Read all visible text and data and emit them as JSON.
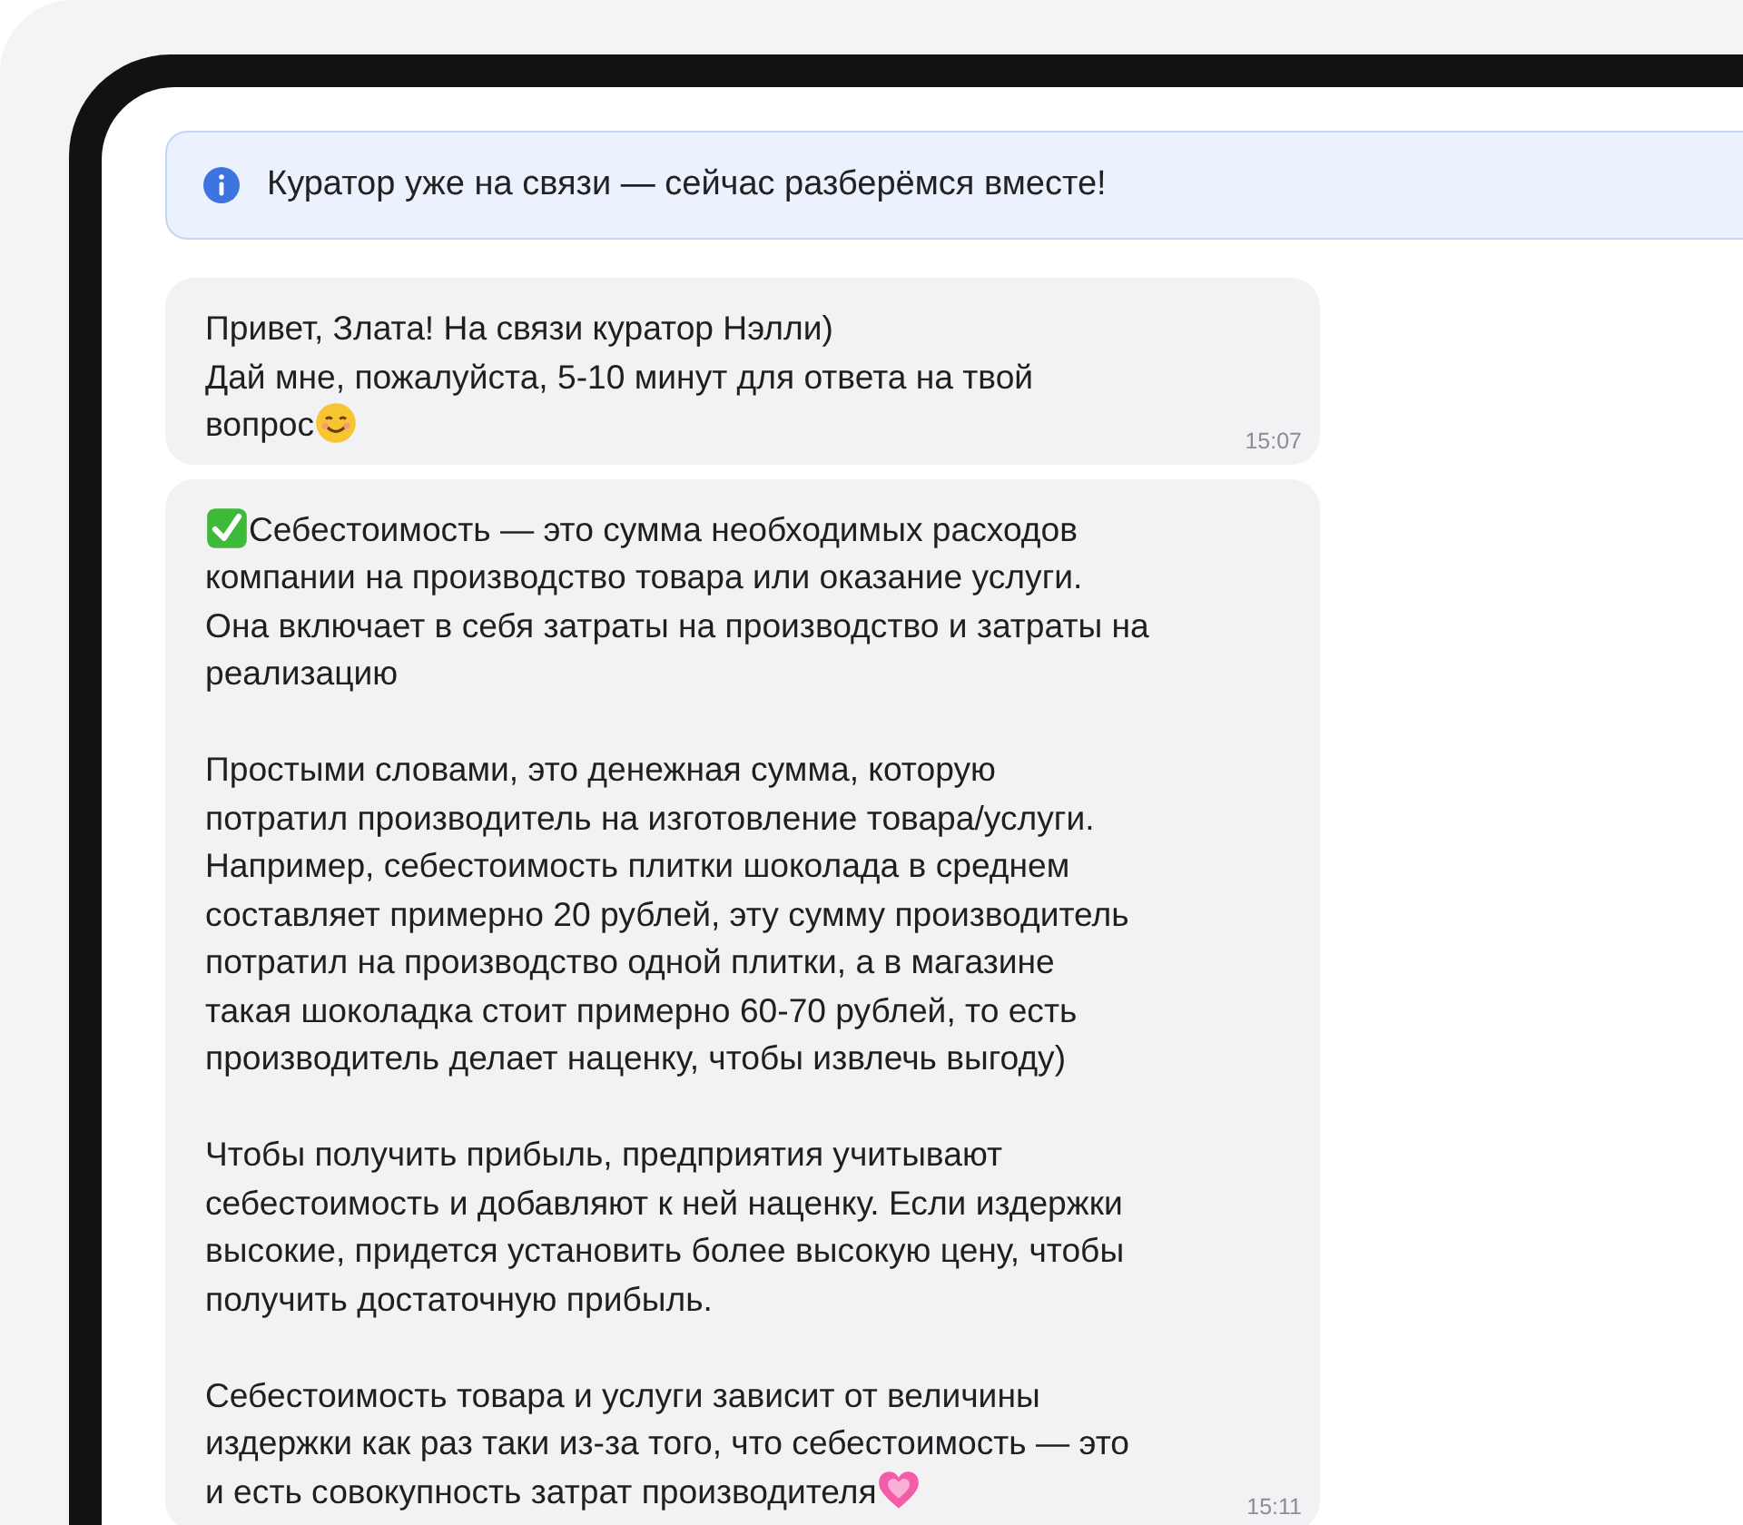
{
  "banner": {
    "text": "Куратор уже на связи — сейчас разберёмся вместе!"
  },
  "messages": [
    {
      "paragraphs": [
        {
          "text": "Привет, Злата! На связи куратор Нэлли)\nДай мне, пожалуйста, 5-10 минут для ответа на твой\nвопрос",
          "kind": "smile-last"
        }
      ],
      "time": "15:07"
    },
    {
      "paragraphs": [
        {
          "text": "Себестоимость — это сумма необходимых расходов\nкомпании на производство товара или оказание услуги.\nОна включает в себя затраты на производство и затраты на\nреализацию",
          "kind": "check-first"
        },
        {
          "text": "Простыми словами, это денежная сумма, которую\nпотратил производитель на изготовление товара/услуги.\nНапример, себестоимость плитки шоколада в среднем\nсоставляет примерно 20 рублей, эту сумму производитель\nпотратил на производство одной плитки, а в магазине\nтакая шоколадка стоит примерно 60-70 рублей, то есть\nпроизводитель делает наценку, чтобы извлечь выгоду)",
          "kind": "plain"
        },
        {
          "text": "Чтобы получить прибыль, предприятия учитывают\nсебестоимость и добавляют к ней наценку. Если издержки\nвысокие, придется установить более высокую цену, чтобы\nполучить достаточную прибыль.",
          "kind": "plain"
        },
        {
          "text": "Себестоимость товара и услуги зависит от величины\nиздержки как раз таки из-за того, что себестоимость — это\nи есть совокупность затрат производителя",
          "kind": "heart-last"
        }
      ],
      "time": "15:11"
    }
  ]
}
